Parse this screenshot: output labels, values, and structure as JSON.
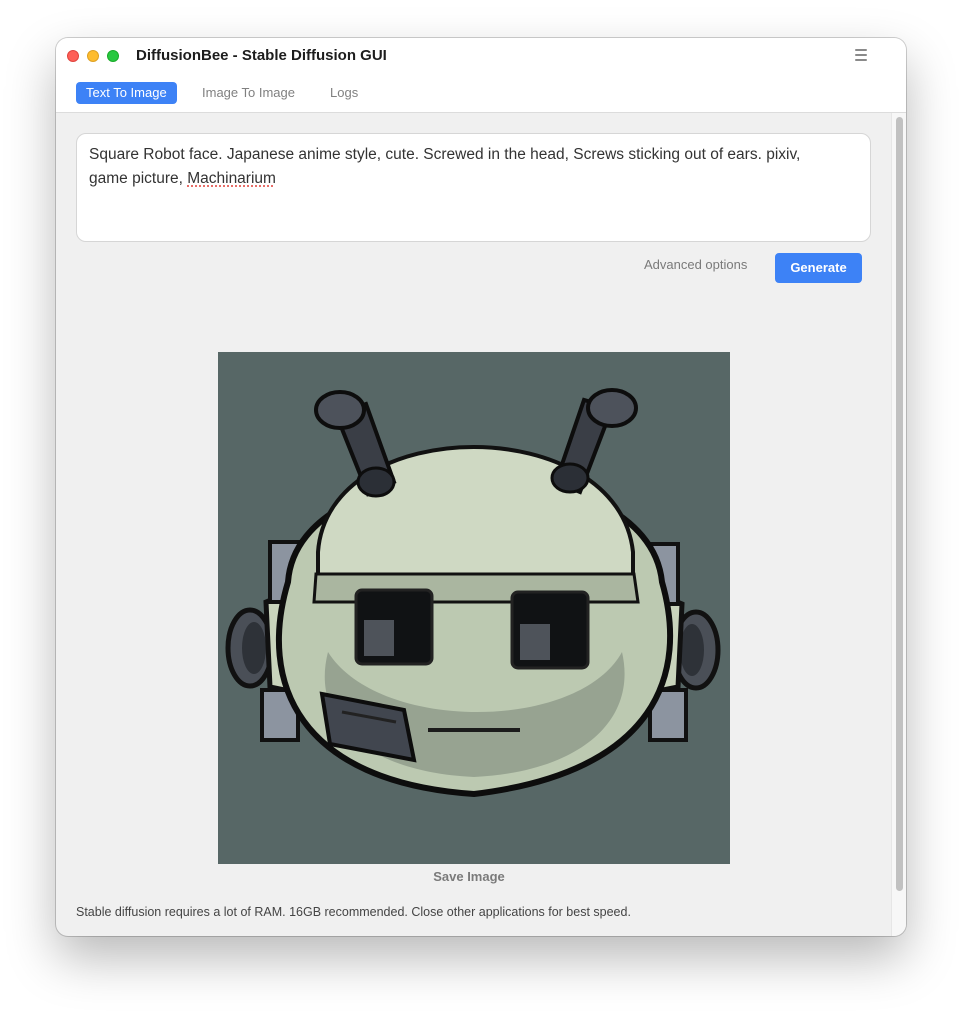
{
  "window": {
    "title": "DiffusionBee - Stable Diffusion GUI",
    "menu_icon": "hamburger-menu-icon"
  },
  "tabs": [
    {
      "label": "Text To Image",
      "active": true
    },
    {
      "label": "Image To Image",
      "active": false
    },
    {
      "label": "Logs",
      "active": false
    }
  ],
  "prompt": {
    "line1": "Square Robot face. Japanese anime style, cute. Screwed in the head, Screws sticking out of ears. pixiv,",
    "line2_prefix": "game picture, ",
    "line2_misspelled": "Machinarium"
  },
  "actions": {
    "advanced_options_label": "Advanced options",
    "generate_label": "Generate"
  },
  "result": {
    "image_subject": "robot-face-illustration",
    "save_label": "Save Image"
  },
  "footer": {
    "note": "Stable diffusion requires a lot of RAM. 16GB recommended. Close other applications for best speed."
  },
  "colors": {
    "accent": "#3d82f6",
    "window_bg": "#f0f0f0",
    "image_bg": "#576766"
  }
}
